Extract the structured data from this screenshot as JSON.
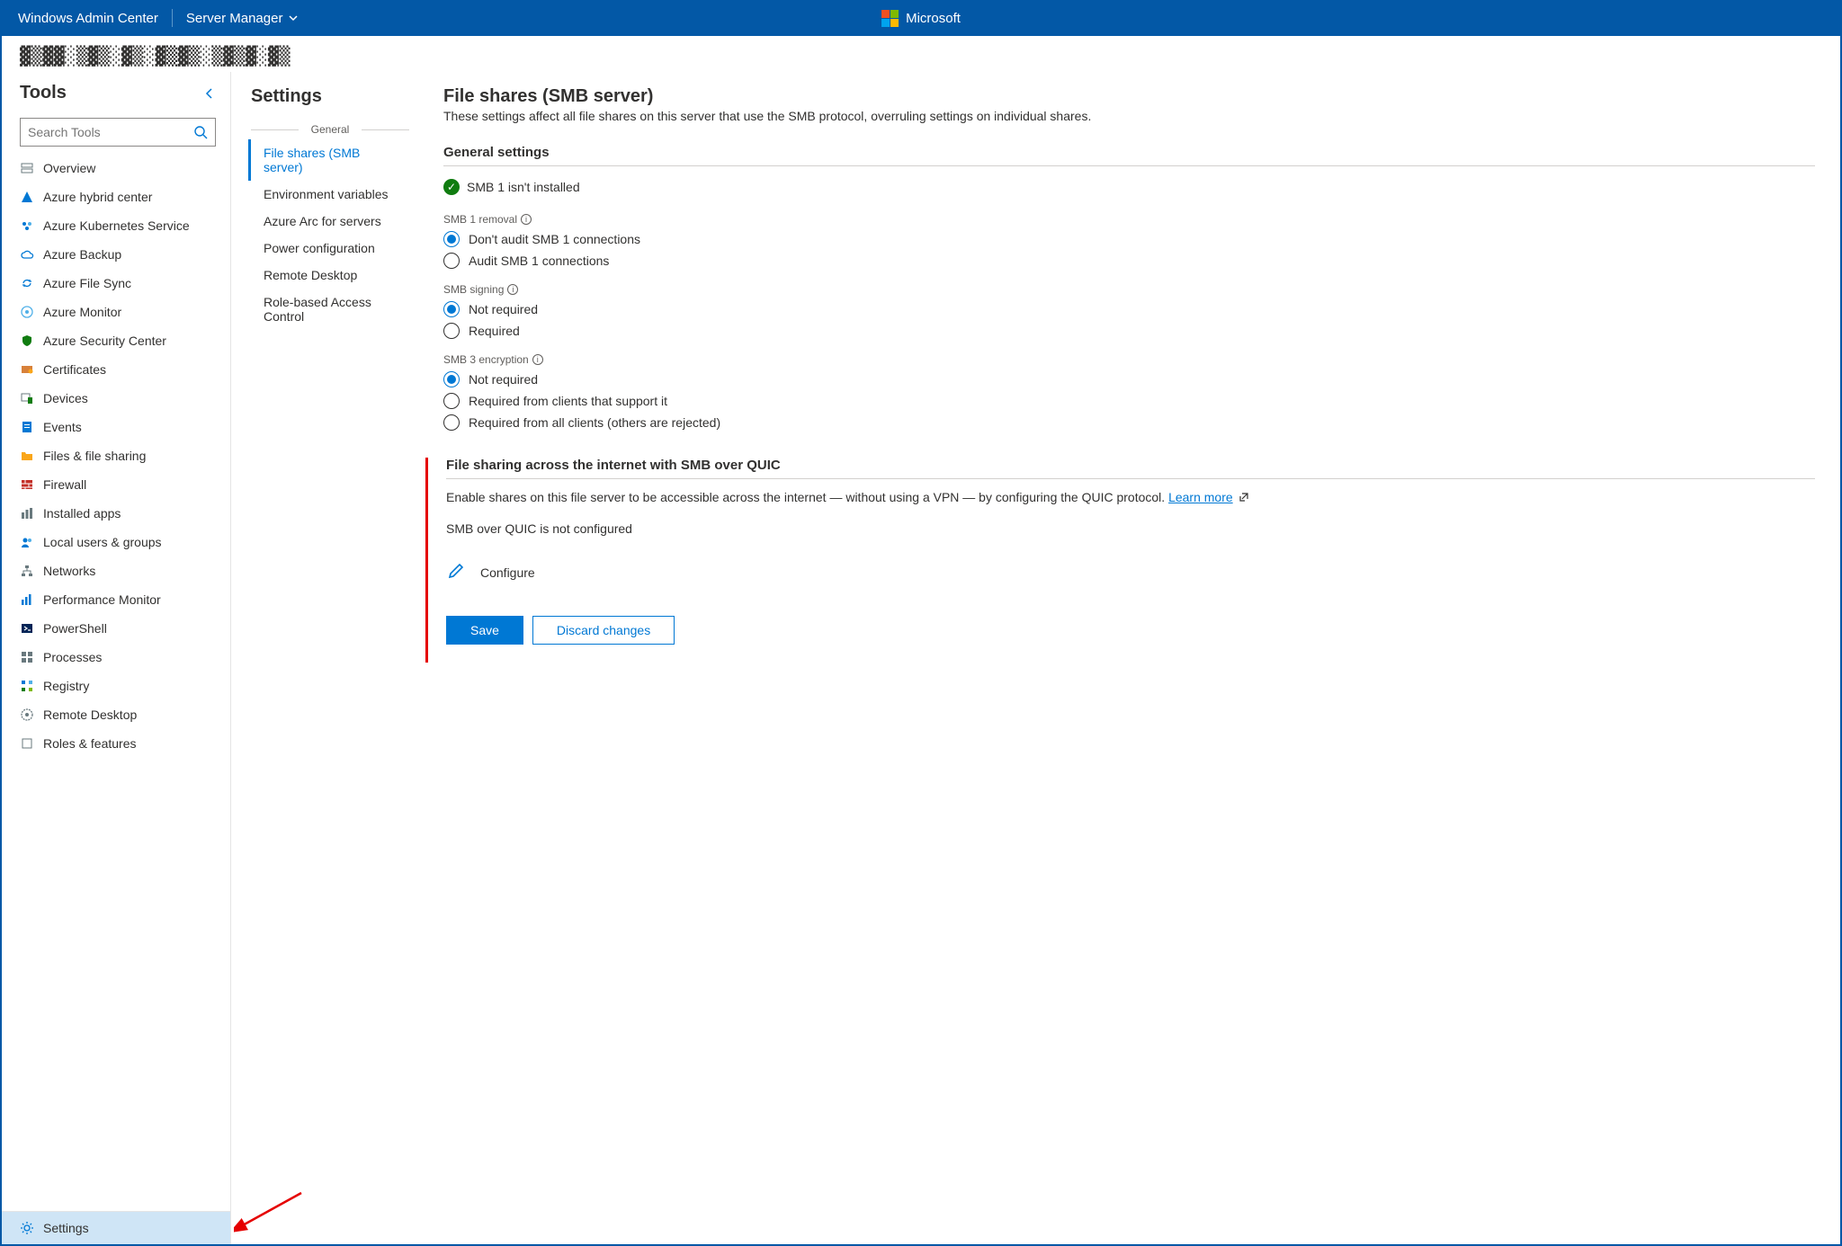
{
  "topbar": {
    "brand": "Windows Admin Center",
    "context": "Server Manager",
    "logo_text": "Microsoft"
  },
  "server_name_redacted": "▓▒▓▓░▒▓▒░▓▒░▓▒▓▒░▒▓▒▓░▓▒",
  "tools": {
    "title": "Tools",
    "search_placeholder": "Search Tools",
    "items": [
      {
        "label": "Overview",
        "icon": "server-icon"
      },
      {
        "label": "Azure hybrid center",
        "icon": "azure-icon"
      },
      {
        "label": "Azure Kubernetes Service",
        "icon": "aks-icon"
      },
      {
        "label": "Azure Backup",
        "icon": "cloud-icon"
      },
      {
        "label": "Azure File Sync",
        "icon": "sync-icon"
      },
      {
        "label": "Azure Monitor",
        "icon": "monitor-icon"
      },
      {
        "label": "Azure Security Center",
        "icon": "shield-icon"
      },
      {
        "label": "Certificates",
        "icon": "cert-icon"
      },
      {
        "label": "Devices",
        "icon": "device-icon"
      },
      {
        "label": "Events",
        "icon": "events-icon"
      },
      {
        "label": "Files & file sharing",
        "icon": "folder-icon"
      },
      {
        "label": "Firewall",
        "icon": "firewall-icon"
      },
      {
        "label": "Installed apps",
        "icon": "apps-icon"
      },
      {
        "label": "Local users & groups",
        "icon": "users-icon"
      },
      {
        "label": "Networks",
        "icon": "network-icon"
      },
      {
        "label": "Performance Monitor",
        "icon": "perf-icon"
      },
      {
        "label": "PowerShell",
        "icon": "powershell-icon"
      },
      {
        "label": "Processes",
        "icon": "process-icon"
      },
      {
        "label": "Registry",
        "icon": "registry-icon"
      },
      {
        "label": "Remote Desktop",
        "icon": "rdp-icon"
      },
      {
        "label": "Roles & features",
        "icon": "roles-icon"
      }
    ],
    "pinned": {
      "label": "Settings",
      "icon": "gear-icon"
    }
  },
  "settings_nav": {
    "title": "Settings",
    "group_label": "General",
    "items": [
      {
        "label": "File shares (SMB server)",
        "active": true
      },
      {
        "label": "Environment variables"
      },
      {
        "label": "Azure Arc for servers"
      },
      {
        "label": "Power configuration"
      },
      {
        "label": "Remote Desktop"
      },
      {
        "label": "Role-based Access Control"
      }
    ]
  },
  "content": {
    "title": "File shares (SMB server)",
    "subtitle": "These settings affect all file shares on this server that use the SMB protocol, overruling settings on individual shares.",
    "general_heading": "General settings",
    "smb1_status": "SMB 1 isn't installed",
    "smb1_removal": {
      "label": "SMB 1 removal",
      "opt0": "Don't audit SMB 1 connections",
      "opt1": "Audit SMB 1 connections"
    },
    "smb_signing": {
      "label": "SMB signing",
      "opt0": "Not required",
      "opt1": "Required"
    },
    "smb3_enc": {
      "label": "SMB 3 encryption",
      "opt0": "Not required",
      "opt1": "Required from clients that support it",
      "opt2": "Required from all clients (others are rejected)"
    },
    "quic": {
      "heading": "File sharing across the internet with SMB over QUIC",
      "desc_prefix": "Enable shares on this file server to be accessible across the internet — without using a VPN — by configuring the QUIC protocol. ",
      "learn_more": "Learn more",
      "status": "SMB over QUIC is not configured",
      "configure": "Configure"
    },
    "buttons": {
      "save": "Save",
      "discard": "Discard changes"
    }
  }
}
